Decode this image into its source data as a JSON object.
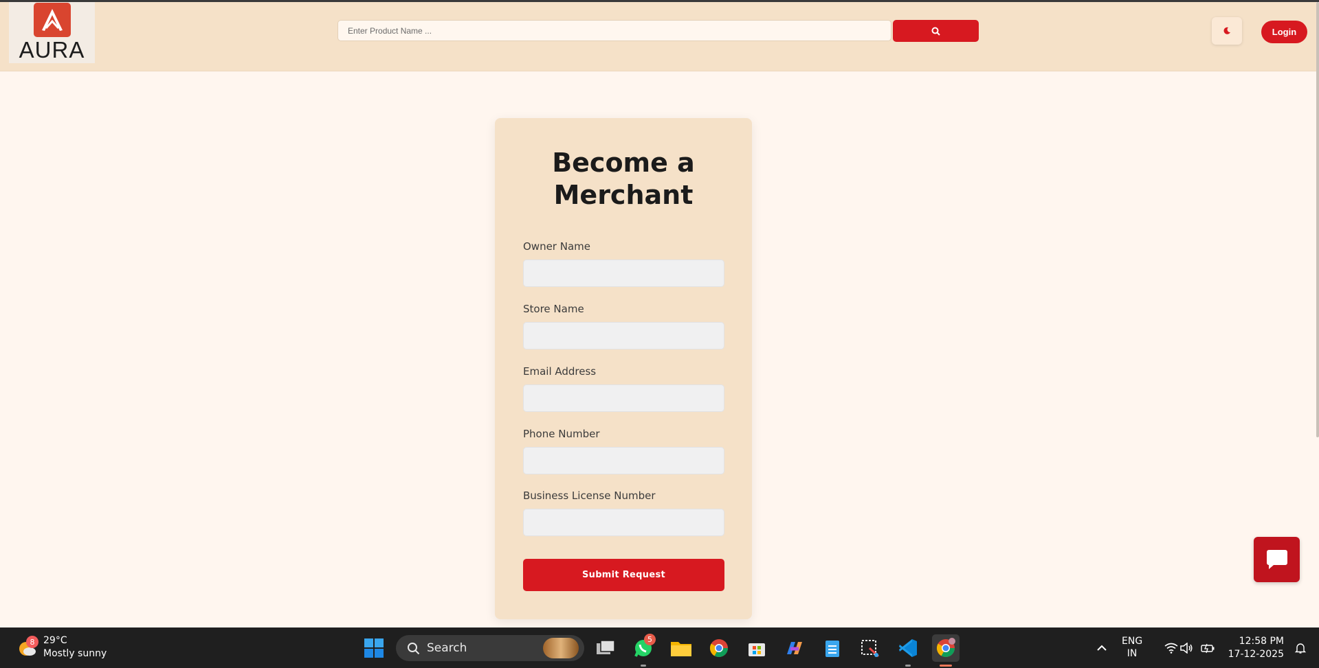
{
  "brand": {
    "logo_text": "AURA",
    "accent": "#d71920",
    "navbar_bg": "#f5e1c8",
    "page_bg": "#fff6ef"
  },
  "search": {
    "placeholder": "Enter Product Name ..."
  },
  "header": {
    "login_label": "Login",
    "theme_toggle_icon": "moon-icon",
    "search_icon": "search-icon"
  },
  "form": {
    "title": "Become a Merchant",
    "fields": [
      {
        "label": "Owner Name",
        "value": ""
      },
      {
        "label": "Store Name",
        "value": ""
      },
      {
        "label": "Email Address",
        "value": ""
      },
      {
        "label": "Phone Number",
        "value": ""
      },
      {
        "label": "Business License Number",
        "value": ""
      }
    ],
    "submit_label": "Submit Request"
  },
  "chat": {
    "icon": "chat-icon"
  },
  "taskbar": {
    "weather": {
      "temp": "29°C",
      "condition": "Mostly sunny",
      "badge": "8"
    },
    "search_label": "Search",
    "apps": [
      {
        "name": "windows-start-icon"
      },
      {
        "name": "task-view-icon"
      },
      {
        "name": "whatsapp-icon",
        "badge": "5"
      },
      {
        "name": "file-explorer-icon"
      },
      {
        "name": "chrome-icon"
      },
      {
        "name": "microsoft-store-icon"
      },
      {
        "name": "copilot-icon"
      },
      {
        "name": "notepad-icon"
      },
      {
        "name": "snipping-tool-icon"
      },
      {
        "name": "vscode-icon"
      },
      {
        "name": "chrome-profile-icon"
      }
    ],
    "language": {
      "line1": "ENG",
      "line2": "IN"
    },
    "clock": {
      "time": "12:58 PM",
      "date": "17-12-2025"
    }
  }
}
